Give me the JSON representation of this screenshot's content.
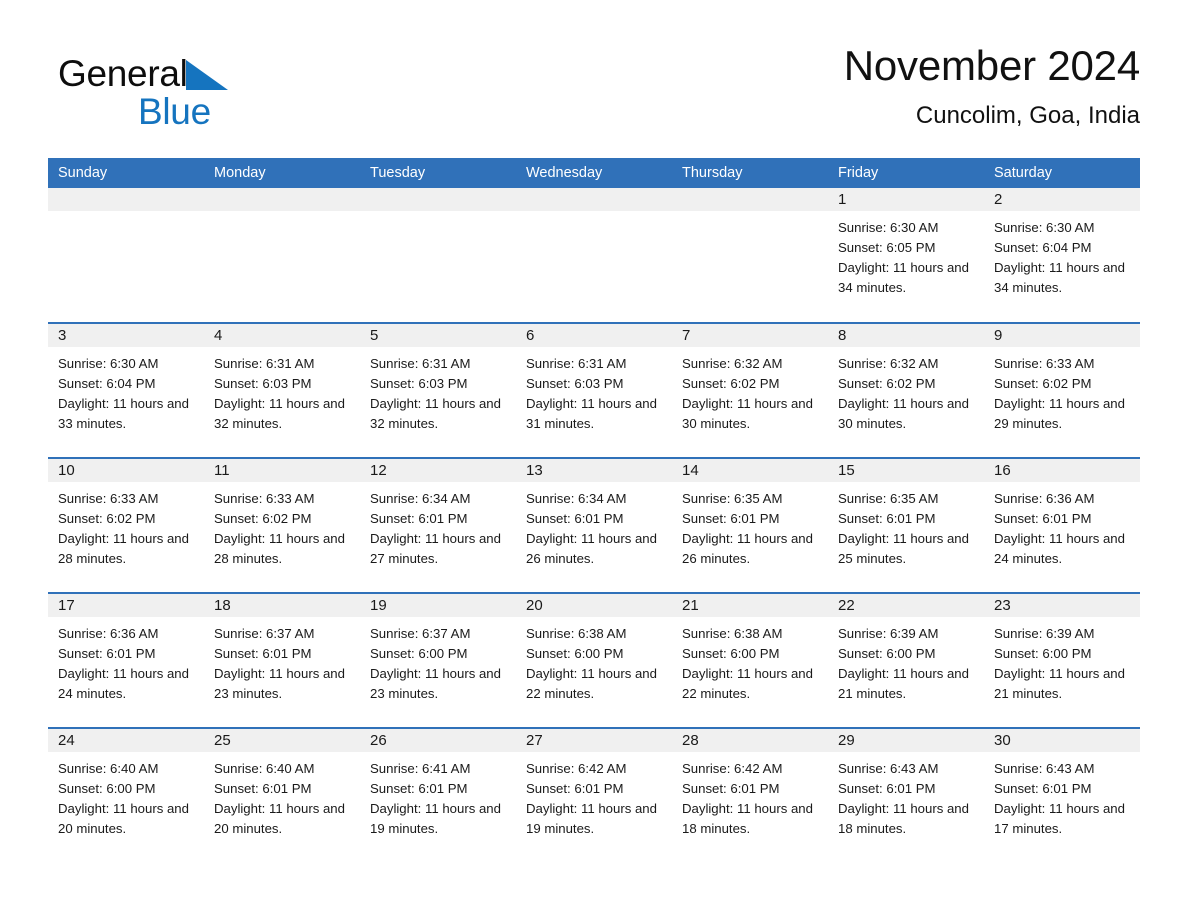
{
  "brand": {
    "name_part1": "General",
    "name_part2": "Blue",
    "triangle_color": "#1574bf",
    "accent_color": "#3071b9"
  },
  "header": {
    "title": "November 2024",
    "subtitle": "Cuncolim, Goa, India"
  },
  "weekdays": [
    "Sunday",
    "Monday",
    "Tuesday",
    "Wednesday",
    "Thursday",
    "Friday",
    "Saturday"
  ],
  "weeks": [
    [
      {
        "day": "",
        "sunrise": "",
        "sunset": "",
        "daylight": ""
      },
      {
        "day": "",
        "sunrise": "",
        "sunset": "",
        "daylight": ""
      },
      {
        "day": "",
        "sunrise": "",
        "sunset": "",
        "daylight": ""
      },
      {
        "day": "",
        "sunrise": "",
        "sunset": "",
        "daylight": ""
      },
      {
        "day": "",
        "sunrise": "",
        "sunset": "",
        "daylight": ""
      },
      {
        "day": "1",
        "sunrise": "Sunrise: 6:30 AM",
        "sunset": "Sunset: 6:05 PM",
        "daylight": "Daylight: 11 hours and 34 minutes."
      },
      {
        "day": "2",
        "sunrise": "Sunrise: 6:30 AM",
        "sunset": "Sunset: 6:04 PM",
        "daylight": "Daylight: 11 hours and 34 minutes."
      }
    ],
    [
      {
        "day": "3",
        "sunrise": "Sunrise: 6:30 AM",
        "sunset": "Sunset: 6:04 PM",
        "daylight": "Daylight: 11 hours and 33 minutes."
      },
      {
        "day": "4",
        "sunrise": "Sunrise: 6:31 AM",
        "sunset": "Sunset: 6:03 PM",
        "daylight": "Daylight: 11 hours and 32 minutes."
      },
      {
        "day": "5",
        "sunrise": "Sunrise: 6:31 AM",
        "sunset": "Sunset: 6:03 PM",
        "daylight": "Daylight: 11 hours and 32 minutes."
      },
      {
        "day": "6",
        "sunrise": "Sunrise: 6:31 AM",
        "sunset": "Sunset: 6:03 PM",
        "daylight": "Daylight: 11 hours and 31 minutes."
      },
      {
        "day": "7",
        "sunrise": "Sunrise: 6:32 AM",
        "sunset": "Sunset: 6:02 PM",
        "daylight": "Daylight: 11 hours and 30 minutes."
      },
      {
        "day": "8",
        "sunrise": "Sunrise: 6:32 AM",
        "sunset": "Sunset: 6:02 PM",
        "daylight": "Daylight: 11 hours and 30 minutes."
      },
      {
        "day": "9",
        "sunrise": "Sunrise: 6:33 AM",
        "sunset": "Sunset: 6:02 PM",
        "daylight": "Daylight: 11 hours and 29 minutes."
      }
    ],
    [
      {
        "day": "10",
        "sunrise": "Sunrise: 6:33 AM",
        "sunset": "Sunset: 6:02 PM",
        "daylight": "Daylight: 11 hours and 28 minutes."
      },
      {
        "day": "11",
        "sunrise": "Sunrise: 6:33 AM",
        "sunset": "Sunset: 6:02 PM",
        "daylight": "Daylight: 11 hours and 28 minutes."
      },
      {
        "day": "12",
        "sunrise": "Sunrise: 6:34 AM",
        "sunset": "Sunset: 6:01 PM",
        "daylight": "Daylight: 11 hours and 27 minutes."
      },
      {
        "day": "13",
        "sunrise": "Sunrise: 6:34 AM",
        "sunset": "Sunset: 6:01 PM",
        "daylight": "Daylight: 11 hours and 26 minutes."
      },
      {
        "day": "14",
        "sunrise": "Sunrise: 6:35 AM",
        "sunset": "Sunset: 6:01 PM",
        "daylight": "Daylight: 11 hours and 26 minutes."
      },
      {
        "day": "15",
        "sunrise": "Sunrise: 6:35 AM",
        "sunset": "Sunset: 6:01 PM",
        "daylight": "Daylight: 11 hours and 25 minutes."
      },
      {
        "day": "16",
        "sunrise": "Sunrise: 6:36 AM",
        "sunset": "Sunset: 6:01 PM",
        "daylight": "Daylight: 11 hours and 24 minutes."
      }
    ],
    [
      {
        "day": "17",
        "sunrise": "Sunrise: 6:36 AM",
        "sunset": "Sunset: 6:01 PM",
        "daylight": "Daylight: 11 hours and 24 minutes."
      },
      {
        "day": "18",
        "sunrise": "Sunrise: 6:37 AM",
        "sunset": "Sunset: 6:01 PM",
        "daylight": "Daylight: 11 hours and 23 minutes."
      },
      {
        "day": "19",
        "sunrise": "Sunrise: 6:37 AM",
        "sunset": "Sunset: 6:00 PM",
        "daylight": "Daylight: 11 hours and 23 minutes."
      },
      {
        "day": "20",
        "sunrise": "Sunrise: 6:38 AM",
        "sunset": "Sunset: 6:00 PM",
        "daylight": "Daylight: 11 hours and 22 minutes."
      },
      {
        "day": "21",
        "sunrise": "Sunrise: 6:38 AM",
        "sunset": "Sunset: 6:00 PM",
        "daylight": "Daylight: 11 hours and 22 minutes."
      },
      {
        "day": "22",
        "sunrise": "Sunrise: 6:39 AM",
        "sunset": "Sunset: 6:00 PM",
        "daylight": "Daylight: 11 hours and 21 minutes."
      },
      {
        "day": "23",
        "sunrise": "Sunrise: 6:39 AM",
        "sunset": "Sunset: 6:00 PM",
        "daylight": "Daylight: 11 hours and 21 minutes."
      }
    ],
    [
      {
        "day": "24",
        "sunrise": "Sunrise: 6:40 AM",
        "sunset": "Sunset: 6:00 PM",
        "daylight": "Daylight: 11 hours and 20 minutes."
      },
      {
        "day": "25",
        "sunrise": "Sunrise: 6:40 AM",
        "sunset": "Sunset: 6:01 PM",
        "daylight": "Daylight: 11 hours and 20 minutes."
      },
      {
        "day": "26",
        "sunrise": "Sunrise: 6:41 AM",
        "sunset": "Sunset: 6:01 PM",
        "daylight": "Daylight: 11 hours and 19 minutes."
      },
      {
        "day": "27",
        "sunrise": "Sunrise: 6:42 AM",
        "sunset": "Sunset: 6:01 PM",
        "daylight": "Daylight: 11 hours and 19 minutes."
      },
      {
        "day": "28",
        "sunrise": "Sunrise: 6:42 AM",
        "sunset": "Sunset: 6:01 PM",
        "daylight": "Daylight: 11 hours and 18 minutes."
      },
      {
        "day": "29",
        "sunrise": "Sunrise: 6:43 AM",
        "sunset": "Sunset: 6:01 PM",
        "daylight": "Daylight: 11 hours and 18 minutes."
      },
      {
        "day": "30",
        "sunrise": "Sunrise: 6:43 AM",
        "sunset": "Sunset: 6:01 PM",
        "daylight": "Daylight: 11 hours and 17 minutes."
      }
    ]
  ]
}
